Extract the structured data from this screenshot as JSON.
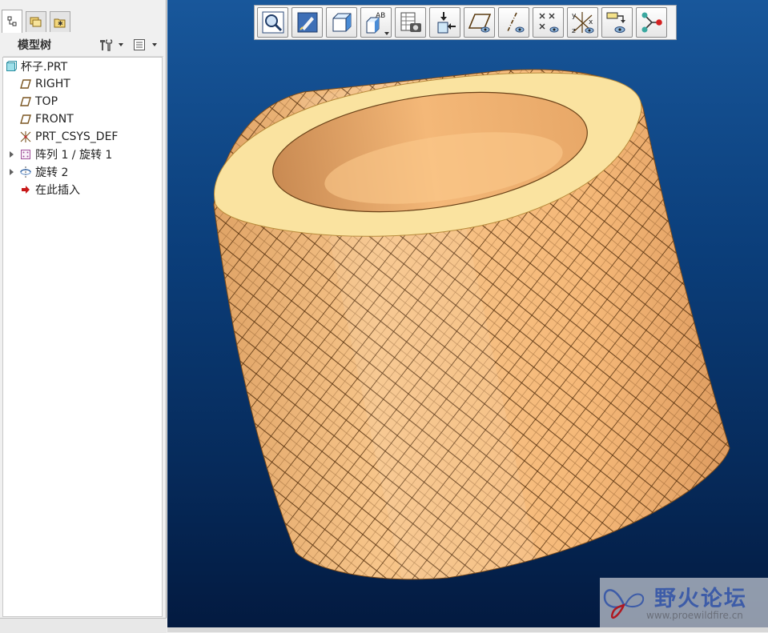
{
  "left_panel": {
    "tabs": [
      {
        "name": "model-tree-tab",
        "icon": "model-tree-icon",
        "active": true
      },
      {
        "name": "layers-tab",
        "icon": "folders-icon",
        "active": false
      },
      {
        "name": "favorites-tab",
        "icon": "favorites-folder-icon",
        "active": false
      }
    ],
    "title": "模型树",
    "settings_icon": "tools-icon",
    "show_icon": "list-view-icon",
    "tree": [
      {
        "label": "杯子.PRT",
        "icon": "part-icon",
        "expandable": false
      },
      {
        "label": "RIGHT",
        "icon": "datum-plane-icon",
        "expandable": false
      },
      {
        "label": "TOP",
        "icon": "datum-plane-icon",
        "expandable": false
      },
      {
        "label": "FRONT",
        "icon": "datum-plane-icon",
        "expandable": false
      },
      {
        "label": "PRT_CSYS_DEF",
        "icon": "csys-icon",
        "expandable": false
      },
      {
        "label": "阵列 1 / 旋转 1",
        "icon": "pattern-icon",
        "expandable": true
      },
      {
        "label": "旋转 2",
        "icon": "revolve-icon",
        "expandable": true
      },
      {
        "label": "在此插入",
        "icon": "insert-here-arrow-icon",
        "expandable": false
      }
    ]
  },
  "toolbar": {
    "buttons": [
      {
        "name": "refit-zoom-button",
        "icon": "magnifier-icon"
      },
      {
        "name": "repaint-button",
        "icon": "repaint-icon"
      },
      {
        "name": "display-style-button",
        "icon": "shaded-cube-icon",
        "dropdown": false
      },
      {
        "name": "saved-views-button",
        "icon": "saved-view-icon",
        "dropdown": true,
        "label": "AB"
      },
      {
        "name": "view-manager-button",
        "icon": "view-manager-icon"
      },
      {
        "name": "insert-datum-button",
        "icon": "insert-datum-icon"
      },
      {
        "name": "plane-display-button",
        "icon": "plane-display-icon"
      },
      {
        "name": "axis-display-button",
        "icon": "axis-display-icon"
      },
      {
        "name": "point-display-button",
        "icon": "point-display-icon"
      },
      {
        "name": "csys-display-button",
        "icon": "csys-display-icon",
        "axes": [
          "y",
          "x",
          "z"
        ]
      },
      {
        "name": "annotation-display-button",
        "icon": "annotation-icon"
      },
      {
        "name": "spin-center-button",
        "icon": "spin-center-icon"
      }
    ]
  },
  "colors": {
    "model_side": "#f5b878",
    "model_top": "#fae3a0",
    "viewport_top": "#18579b",
    "viewport_bottom": "#031a40"
  },
  "watermark": {
    "title": "野火论坛",
    "url": "www.proewildfire.cn"
  }
}
